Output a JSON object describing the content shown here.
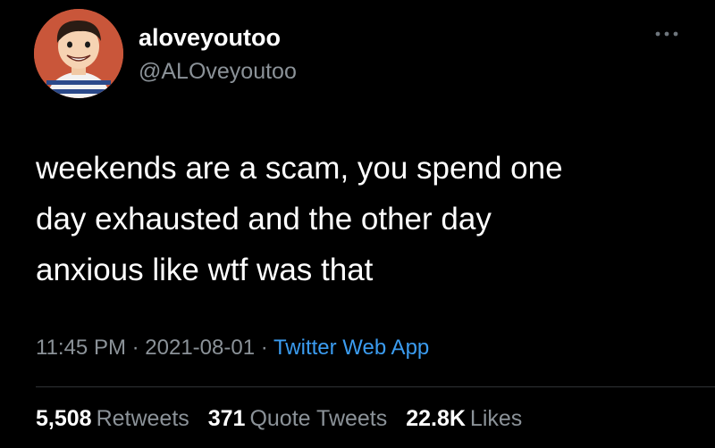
{
  "tweet": {
    "display_name": "aloveyoutoo",
    "handle": "@ALOveyoutoo",
    "text": "weekends are a scam, you spend one\nday exhausted and the other day\nanxious like wtf was that",
    "time": "11:45 PM",
    "separator": " · ",
    "date": "2021-08-01",
    "source": "Twitter Web App"
  },
  "stats": {
    "retweets_count": "5,508",
    "retweets_label": "Retweets",
    "quotes_count": "371",
    "quotes_label": "Quote Tweets",
    "likes_count": "22.8K",
    "likes_label": "Likes"
  },
  "icons": {
    "more": "more-horizontal-icon",
    "avatar": "cartoon-avatar"
  },
  "colors": {
    "background": "#000000",
    "text": "#ffffff",
    "secondary": "#8b9298",
    "link": "#3b9cf0",
    "divider": "#2f3336"
  }
}
